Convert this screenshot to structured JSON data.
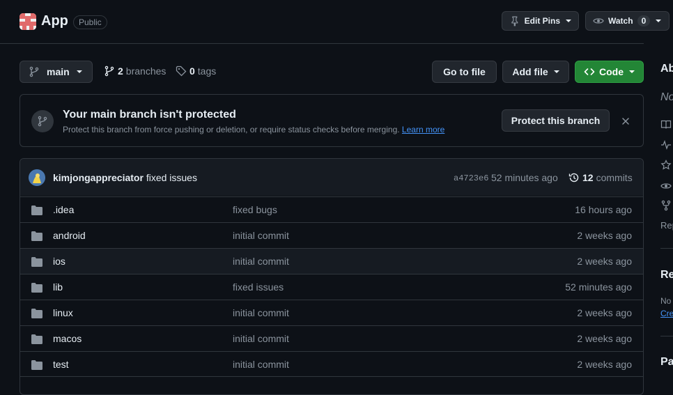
{
  "repo": {
    "name": "App",
    "visibility": "Public"
  },
  "header_actions": {
    "edit_pins": "Edit Pins",
    "watch": "Watch",
    "watch_count": "0"
  },
  "toolbar": {
    "branch": "main",
    "branches_count": "2",
    "branches_label": "branches",
    "tags_count": "0",
    "tags_label": "tags",
    "go_to_file": "Go to file",
    "add_file": "Add file",
    "code": "Code"
  },
  "banner": {
    "title": "Your main branch isn't protected",
    "desc": "Protect this branch from force pushing or deletion, or require status checks before merging.",
    "learn_more": "Learn more",
    "protect_button": "Protect this branch"
  },
  "latest_commit": {
    "author": "kimjongappreciator",
    "message": "fixed issues",
    "sha": "a4723e6",
    "time": "52 minutes ago",
    "commits_count": "12",
    "commits_label": "commits"
  },
  "files": [
    {
      "name": ".idea",
      "message": "fixed bugs",
      "time": "16 hours ago"
    },
    {
      "name": "android",
      "message": "initial commit",
      "time": "2 weeks ago"
    },
    {
      "name": "ios",
      "message": "initial commit",
      "time": "2 weeks ago"
    },
    {
      "name": "lib",
      "message": "fixed issues",
      "time": "52 minutes ago"
    },
    {
      "name": "linux",
      "message": "initial commit",
      "time": "2 weeks ago"
    },
    {
      "name": "macos",
      "message": "initial commit",
      "time": "2 weeks ago"
    },
    {
      "name": "test",
      "message": "initial commit",
      "time": "2 weeks ago"
    }
  ],
  "sidebar": {
    "about_heading": "Ab",
    "no_desc": "No",
    "rep": "Rep",
    "releases_heading": "Re",
    "releases_no": "No",
    "releases_create": "Cre",
    "packages_heading": "Pa"
  },
  "colors": {
    "accent_green": "#238636",
    "link_blue": "#4493f8",
    "bg": "#0d1117"
  }
}
